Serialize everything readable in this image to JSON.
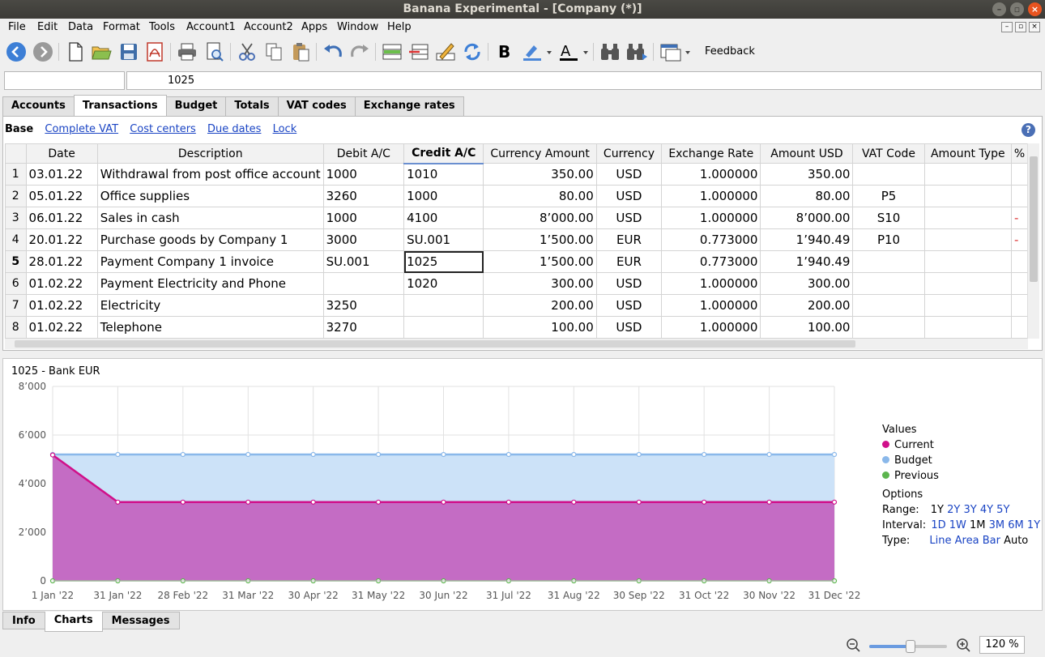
{
  "window": {
    "title": "Banana Experimental - [Company (*)]"
  },
  "menu": [
    "File",
    "Edit",
    "Data",
    "Format",
    "Tools",
    "Account1",
    "Account2",
    "Apps",
    "Window",
    "Help"
  ],
  "toolbar": {
    "feedback_label": "Feedback"
  },
  "address": {
    "cell_ref": "",
    "cell_value": "1025"
  },
  "tabs": [
    "Accounts",
    "Transactions",
    "Budget",
    "Totals",
    "VAT codes",
    "Exchange rates"
  ],
  "views": {
    "base": "Base",
    "links": [
      "Complete VAT",
      "Cost centers",
      "Due dates",
      "Lock"
    ]
  },
  "table": {
    "columns": [
      "Date",
      "Description",
      "Debit A/C",
      "Credit A/C",
      "Currency Amount",
      "Currency",
      "Exchange Rate",
      "Amount USD",
      "VAT Code",
      "Amount Type",
      "%"
    ],
    "rows": [
      [
        "1",
        "03.01.22",
        "Withdrawal from post office account",
        "1000",
        "1010",
        "350.00",
        "USD",
        "1.000000",
        "350.00",
        "",
        "",
        ""
      ],
      [
        "2",
        "05.01.22",
        "Office supplies",
        "3260",
        "1000",
        "80.00",
        "USD",
        "1.000000",
        "80.00",
        "P5",
        "",
        ""
      ],
      [
        "3",
        "06.01.22",
        "Sales in cash",
        "1000",
        "4100",
        "8’000.00",
        "USD",
        "1.000000",
        "8’000.00",
        "S10",
        "",
        "-"
      ],
      [
        "4",
        "20.01.22",
        "Purchase goods by Company 1",
        "3000",
        "SU.001",
        "1’500.00",
        "EUR",
        "0.773000",
        "1’940.49",
        "P10",
        "",
        "-"
      ],
      [
        "5",
        "28.01.22",
        "Payment Company 1 invoice",
        "SU.001",
        "1025",
        "1’500.00",
        "EUR",
        "0.773000",
        "1’940.49",
        "",
        "",
        ""
      ],
      [
        "6",
        "01.02.22",
        "Payment Electricity and Phone",
        "",
        "1020",
        "300.00",
        "USD",
        "1.000000",
        "300.00",
        "",
        "",
        ""
      ],
      [
        "7",
        "01.02.22",
        "Electricity",
        "3250",
        "",
        "200.00",
        "USD",
        "1.000000",
        "200.00",
        "",
        "",
        ""
      ],
      [
        "8",
        "01.02.22",
        "Telephone",
        "3270",
        "",
        "100.00",
        "USD",
        "1.000000",
        "100.00",
        "",
        "",
        ""
      ]
    ]
  },
  "chart_panel": {
    "legend_title": "Values",
    "legend": [
      {
        "label": "Current",
        "color": "#d0108a"
      },
      {
        "label": "Budget",
        "color": "#8ab8ea"
      },
      {
        "label": "Previous",
        "color": "#5cb54e"
      }
    ],
    "options_title": "Options",
    "range_label": "Range:",
    "range": [
      "1Y",
      "2Y",
      "3Y",
      "4Y",
      "5Y"
    ],
    "interval_label": "Interval:",
    "interval": [
      "1D",
      "1W",
      "1M",
      "3M",
      "6M",
      "1Y"
    ],
    "type_label": "Type:",
    "types": [
      "Line",
      "Area",
      "Bar",
      "Auto"
    ]
  },
  "chart_data": {
    "type": "area",
    "title": "1025 - Bank EUR",
    "x": [
      "1 Jan '22",
      "31 Jan '22",
      "28 Feb '22",
      "31 Mar '22",
      "30 Apr '22",
      "31 May '22",
      "30 Jun '22",
      "31 Jul '22",
      "31 Aug '22",
      "30 Sep '22",
      "31 Oct '22",
      "30 Nov '22",
      "31 Dec '22"
    ],
    "series": [
      {
        "name": "Budget",
        "values": [
          5200,
          5200,
          5200,
          5200,
          5200,
          5200,
          5200,
          5200,
          5200,
          5200,
          5200,
          5200,
          5200
        ]
      },
      {
        "name": "Current",
        "values": [
          5180,
          3240,
          3240,
          3240,
          3240,
          3240,
          3240,
          3240,
          3240,
          3240,
          3240,
          3240,
          3240
        ]
      },
      {
        "name": "Previous",
        "values": [
          0,
          0,
          0,
          0,
          0,
          0,
          0,
          0,
          0,
          0,
          0,
          0,
          0
        ]
      }
    ],
    "ylim": [
      0,
      8000
    ],
    "yticks": [
      "0",
      "2’000",
      "4’000",
      "6’000",
      "8’000"
    ],
    "xlabel": "",
    "ylabel": "",
    "grid": true,
    "legend_position": "right"
  },
  "bottom_tabs": [
    "Info",
    "Charts",
    "Messages"
  ],
  "status": {
    "zoom": "120 %"
  }
}
